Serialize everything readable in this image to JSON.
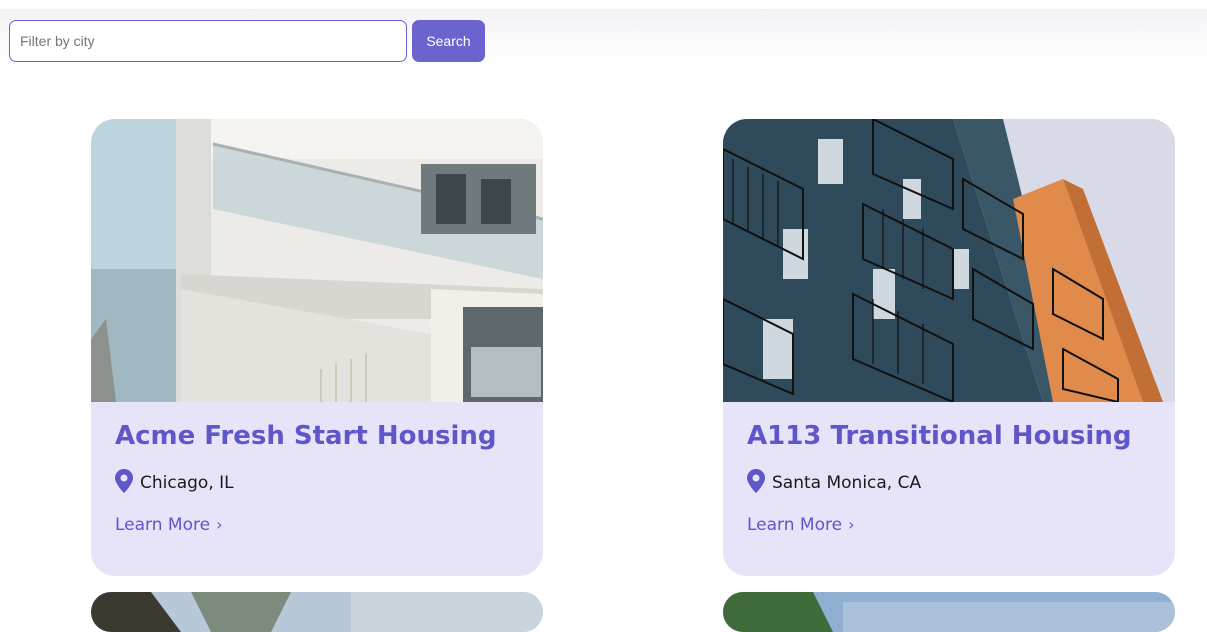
{
  "search": {
    "placeholder": "Filter by city",
    "value": "",
    "button_label": "Search"
  },
  "listings": [
    {
      "title": "Acme Fresh Start Housing",
      "location": "Chicago, IL",
      "link_label": "Learn More",
      "image": "white modern building with glass balconies"
    },
    {
      "title": "A113 Transitional Housing",
      "location": "Santa Monica, CA",
      "link_label": "Learn More",
      "image": "blue and orange apartment building with balconies"
    }
  ],
  "icons": {
    "location": "map-pin-icon",
    "link": "chevron-right-icon"
  },
  "colors": {
    "accent": "#6d63cf",
    "title": "#5e56c9",
    "card_bg": "#e7e4f9"
  }
}
